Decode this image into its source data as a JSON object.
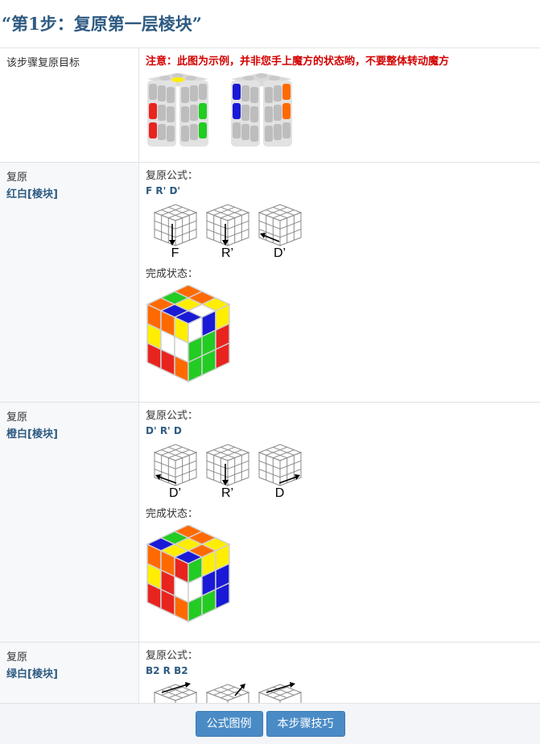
{
  "title": "“第1步：复原第一层棱块”",
  "rows": [
    {
      "left_text": "该步骤复原目标",
      "note": "注意：此图为示例，并非您手上魔方的状态哟，不要整体转动魔方"
    },
    {
      "left_text": "复原",
      "edge_name": "红白[棱块]",
      "formula_label": "复原公式：",
      "formula": "F R' D'",
      "moves": [
        "F",
        "R’",
        "D’"
      ],
      "done_label": "完成状态："
    },
    {
      "left_text": "复原",
      "edge_name": "橙白[棱块]",
      "formula_label": "复原公式：",
      "formula": "D' R' D",
      "moves": [
        "D’",
        "R’",
        "D"
      ],
      "done_label": "完成状态："
    },
    {
      "left_text": "复原",
      "edge_name": "绿白[棱块]",
      "formula_label": "复原公式：",
      "formula": "B2 R B2"
    }
  ],
  "footer": {
    "btn_legend": "公式图例",
    "btn_tips": "本步骤技巧"
  },
  "colors": {
    "title": "#2e5b82",
    "note": "#d40000",
    "button": "#4a8bc6",
    "red": "#e8241f",
    "orange": "#ff6a00",
    "yellow": "#ffee00",
    "green": "#22cc22",
    "blue": "#1a1ad6",
    "white": "#ffffff",
    "gray": "#c6c6c6"
  },
  "icons": {
    "move_diagram": "cube-move-diagram-icon",
    "cube_state": "cube-state-icon"
  }
}
